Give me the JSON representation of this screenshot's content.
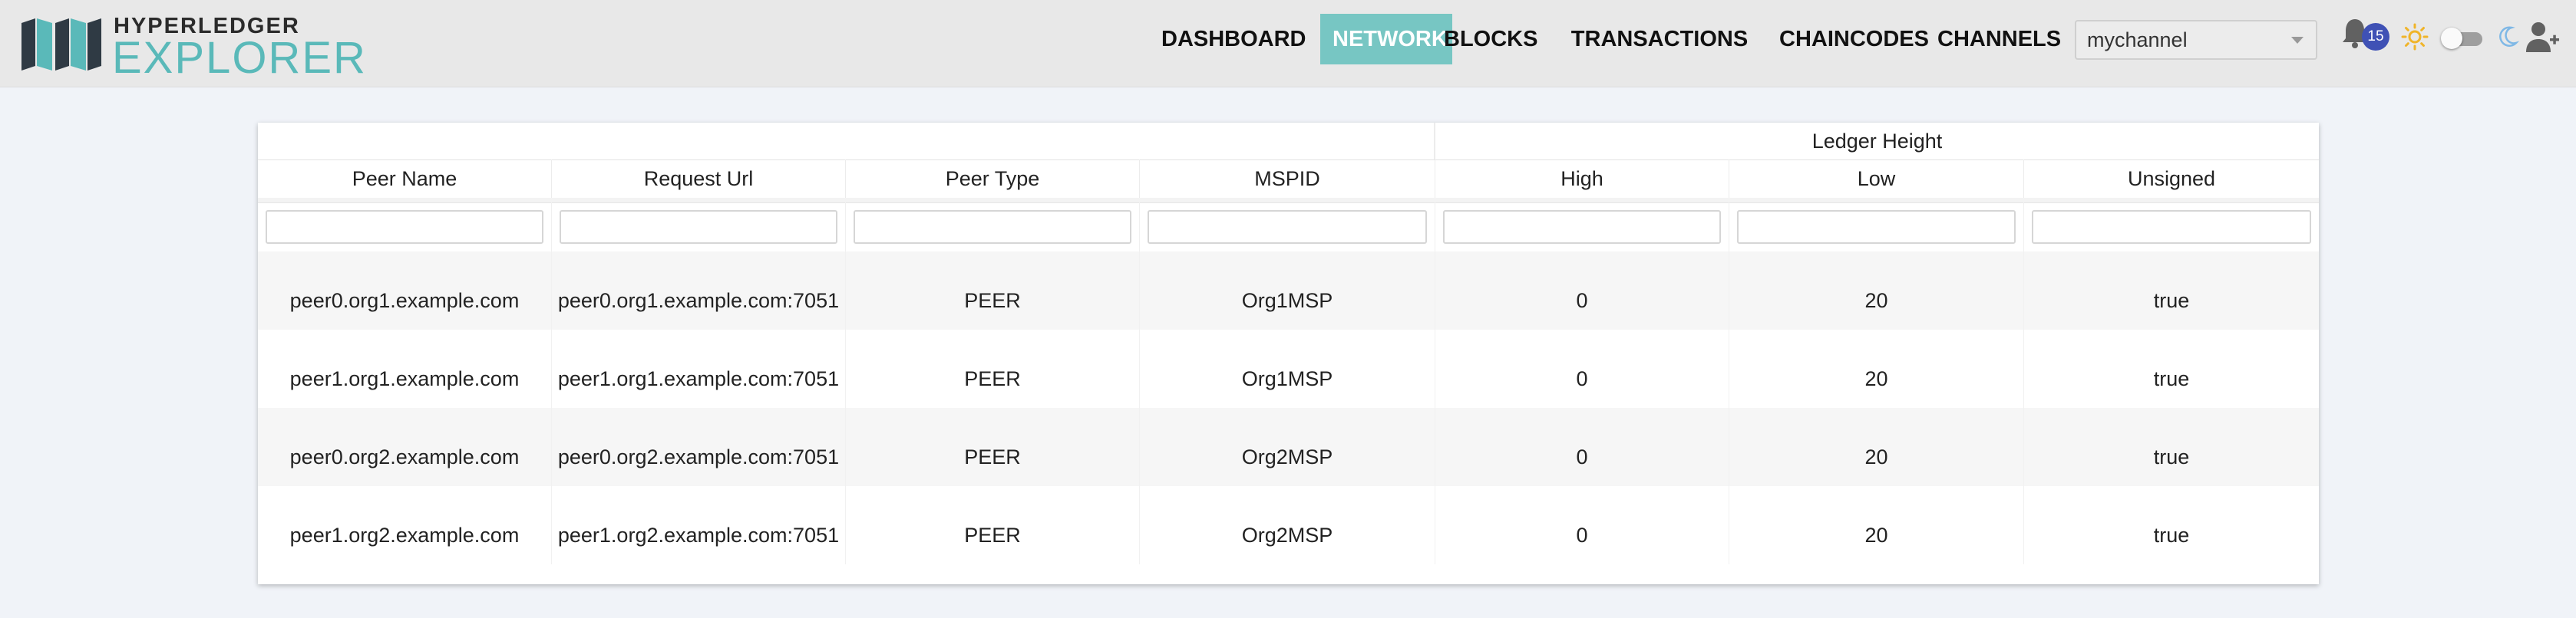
{
  "brand": {
    "top": "HYPERLEDGER",
    "bottom": "EXPLORER",
    "accent": "#5ab9b9"
  },
  "nav": {
    "items": [
      {
        "label": "DASHBOARD",
        "active": false
      },
      {
        "label": "NETWORK",
        "active": true
      },
      {
        "label": "BLOCKS",
        "active": false
      },
      {
        "label": "TRANSACTIONS",
        "active": false
      },
      {
        "label": "CHAINCODES",
        "active": false
      },
      {
        "label": "CHANNELS",
        "active": false
      }
    ],
    "active_color": "#77c6c3"
  },
  "channel_select": {
    "value": "mychannel"
  },
  "toolbar": {
    "notification_icon": "bell-icon",
    "notification_count": "15",
    "sun_icon": "sun-icon",
    "theme_toggle": "toggle-switch",
    "moon_icon": "moon-icon",
    "add_user_icon": "add-user-icon"
  },
  "table": {
    "group_header": "Ledger Height",
    "columns": [
      "Peer Name",
      "Request Url",
      "Peer Type",
      "MSPID",
      "High",
      "Low",
      "Unsigned"
    ],
    "rows": [
      [
        "peer0.org1.example.com",
        "peer0.org1.example.com:7051",
        "PEER",
        "Org1MSP",
        "0",
        "20",
        "true"
      ],
      [
        "peer1.org1.example.com",
        "peer1.org1.example.com:7051",
        "PEER",
        "Org1MSP",
        "0",
        "20",
        "true"
      ],
      [
        "peer0.org2.example.com",
        "peer0.org2.example.com:7051",
        "PEER",
        "Org2MSP",
        "0",
        "20",
        "true"
      ],
      [
        "peer1.org2.example.com",
        "peer1.org2.example.com:7051",
        "PEER",
        "Org2MSP",
        "0",
        "20",
        "true"
      ]
    ]
  }
}
